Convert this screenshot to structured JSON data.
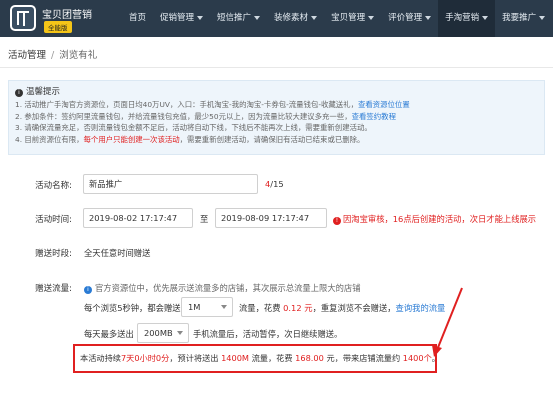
{
  "app": {
    "brand": "宝贝团营销",
    "badge": "全能版"
  },
  "nav": {
    "items": [
      {
        "label": "首页",
        "dropdown": false
      },
      {
        "label": "促销管理",
        "dropdown": true
      },
      {
        "label": "短信推广",
        "dropdown": true
      },
      {
        "label": "装修素材",
        "dropdown": true
      },
      {
        "label": "宝贝管理",
        "dropdown": true
      },
      {
        "label": "评价管理",
        "dropdown": true
      },
      {
        "label": "手淘营销",
        "dropdown": true,
        "active": true
      },
      {
        "label": "我要推广",
        "dropdown": true
      }
    ]
  },
  "breadcrumb": {
    "root": "活动管理",
    "sep": "/",
    "current": "浏览有礼"
  },
  "tips": {
    "title": "温馨提示",
    "line1": "1. 活动推广手淘官方资源位，页面日均40万UV，入口：手机淘宝-我的淘宝-卡券包-流量钱包-收藏送礼，",
    "line1_link": "查看资源位位置",
    "line2": "2. 参加条件：签约阿里流量钱包，并给流量钱包充值，最少50元以上，因为流量比较大建议多充一些，",
    "line2_link": "查看签约教程",
    "line3": "3. 请确保流量充足，否则流量钱包金额不足后，活动将自动下线，下线后不能再次上线，需要重新创建活动。",
    "line4_a": "4. 目前资源位有限，",
    "line4_red": "每个用户只能创建一次该活动",
    "line4_b": "，需要重新创建活动，请确保旧有活动已结束或已删除。"
  },
  "form": {
    "name_label": "活动名称:",
    "name_value": "新品推广",
    "name_count": "4",
    "name_max": "/15",
    "time_label": "活动时间:",
    "start_time": "2019-08-02 17:17:47",
    "to": "至",
    "end_time": "2019-08-09 17:17:47",
    "time_notice": "因淘宝审核，16点后创建的活动，次日才能上线展示",
    "period_label": "赠送时段:",
    "period_value": "全天任意时间赠送",
    "flow_label": "赠送流量:",
    "flow_info": "官方资源位中，优先展示送流量多的店铺，其次展示总流量上限大的店铺",
    "every_text": "每个浏览5秒钟，都会赠送",
    "per_amount": "1M",
    "cost_text": "流量，花费",
    "cost_value": "0.12 元",
    "repeat_text": "，重复浏览不会赠送，",
    "query_link": "查询我的流量",
    "daily_text": "每天最多送出",
    "daily_amount": "200MB",
    "daily_tail": "手机流量后，活动暂停，次日继续赠送。"
  },
  "summary": {
    "p1": "本活动持续",
    "duration": "7天0小时0分",
    "p2": "，预计将送出",
    "total_flow": "1400M",
    "p3": "流量，花费",
    "total_cost": "168.00",
    "p4": "元，带来店铺流量约",
    "visits": "1400个",
    "p5": "。"
  },
  "colors": {
    "nav_bg": "#2b3b4b",
    "accent_red": "#e02020",
    "link_blue": "#2a7bd4",
    "badge_yellow": "#f5c518"
  }
}
